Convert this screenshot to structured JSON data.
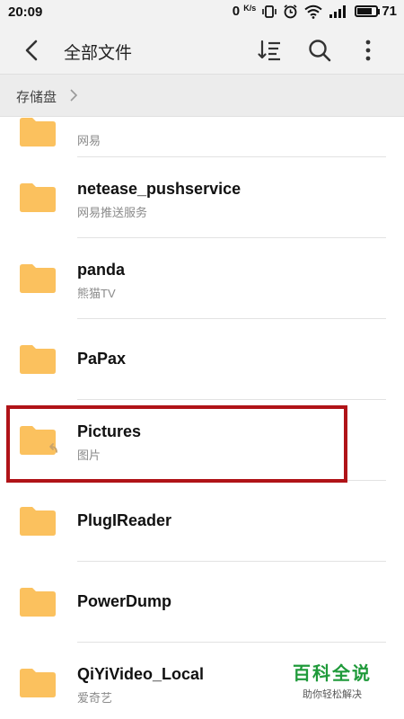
{
  "status_bar": {
    "time": "20:09",
    "speed_value": "0",
    "speed_unit": "K/s",
    "battery": "71"
  },
  "toolbar": {
    "title": "全部文件",
    "icons": [
      "back-arrow-icon",
      "sort-icon",
      "search-icon",
      "more-vert-icon"
    ]
  },
  "breadcrumb": {
    "root": "存储盘"
  },
  "files": [
    {
      "name": "",
      "subtitle": "网易"
    },
    {
      "name": "netease_pushservice",
      "subtitle": "网易推送服务"
    },
    {
      "name": "panda",
      "subtitle": "熊猫TV"
    },
    {
      "name": "PaPax",
      "subtitle": ""
    },
    {
      "name": "Pictures",
      "subtitle": "图片",
      "shortcut_badge": true
    },
    {
      "name": "PlugIReader",
      "subtitle": ""
    },
    {
      "name": "PowerDump",
      "subtitle": ""
    },
    {
      "name": "QiYiVideo_Local",
      "subtitle": "爱奇艺"
    }
  ],
  "colors": {
    "folder": "#fbc15e",
    "highlight_border": "#b01318",
    "watermark": "#1f9a3a"
  },
  "watermark": {
    "title": "百科全说",
    "tagline": "助你轻松解决"
  }
}
